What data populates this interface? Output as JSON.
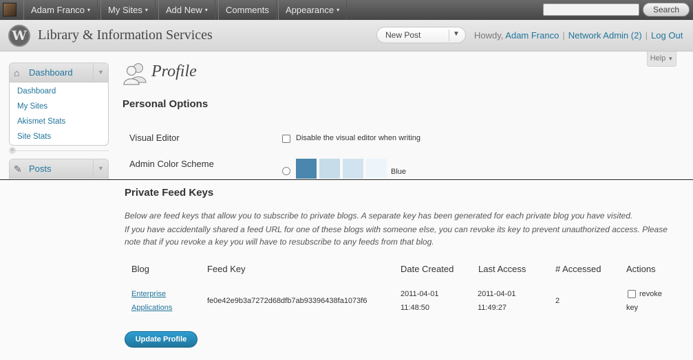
{
  "adminbar": {
    "items": [
      {
        "label": "Adam Franco",
        "caret": "▾"
      },
      {
        "label": "My Sites",
        "caret": "▾"
      },
      {
        "label": "Add New",
        "caret": "▾"
      },
      {
        "label": "Comments",
        "caret": ""
      },
      {
        "label": "Appearance",
        "caret": "▾"
      }
    ],
    "search_value": "",
    "search_button": "Search"
  },
  "header": {
    "site_title": "Library & Information Services",
    "new_post": "New Post",
    "howdy_prefix": "Howdy,",
    "user": "Adam Franco",
    "network_admin": "Network Admin (2)",
    "log_out": "Log Out"
  },
  "help_tab": "Help",
  "sidebar": {
    "dashboard_menu": {
      "title": "Dashboard",
      "items": [
        "Dashboard",
        "My Sites",
        "Akismet Stats",
        "Site Stats"
      ]
    },
    "posts_menu": {
      "title": "Posts"
    }
  },
  "page": {
    "title": "Profile",
    "personal_options": "Personal Options",
    "visual_editor_label": "Visual Editor",
    "visual_editor_option": "Disable the visual editor when writing",
    "color_scheme_label": "Admin Color Scheme",
    "color_scheme_name": "Blue",
    "color_scheme_swatches": [
      "#4a86ad",
      "#c6dce8",
      "#d1e3ee",
      "#eef5fa"
    ]
  },
  "feeds": {
    "heading": "Private Feed Keys",
    "description_1": "Below are feed keys that allow you to subscribe to private blogs. A separate key has been generated for each private blog you have visited.",
    "description_2": "If you have accidentally shared a feed URL for one of these blogs with someone else, you can revoke its key to prevent unauthorized access. Please note that if you revoke a key you will have to resubscribe to any feeds from that blog.",
    "columns": [
      "Blog",
      "Feed Key",
      "Date Created",
      "Last Access",
      "# Accessed",
      "Actions"
    ],
    "rows": [
      {
        "blog_line1": "Enterprise",
        "blog_line2": "Applications",
        "feed_key": "fe0e42e9b3a7272d68dfb7ab93396438fa1073f6",
        "created_date": "2011-04-01",
        "created_time": "11:48:50",
        "access_date": "2011-04-01",
        "access_time": "11:49:27",
        "accessed": "2",
        "action_line1": "revoke",
        "action_line2": "key"
      }
    ]
  },
  "update_button": "Update Profile"
}
